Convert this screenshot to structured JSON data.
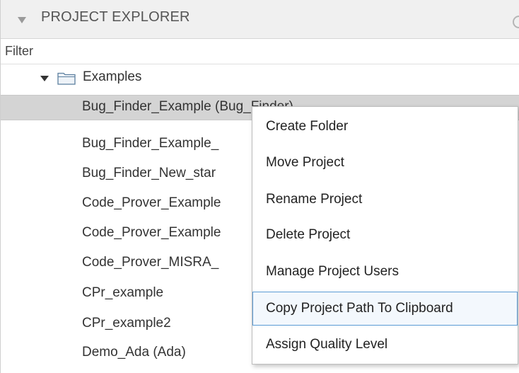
{
  "header": {
    "title": "PROJECT EXPLORER"
  },
  "filter": {
    "placeholder": "Filter",
    "value": ""
  },
  "tree": {
    "folder": {
      "label": "Examples",
      "expanded": true,
      "icon": "folder-icon"
    },
    "projects": [
      {
        "label": "Bug_Finder_Example (Bug_Finder)",
        "selected": true
      },
      {
        "label": "Bug_Finder_Example_"
      },
      {
        "label": "Bug_Finder_New_star"
      },
      {
        "label": "Code_Prover_Example"
      },
      {
        "label": "Code_Prover_Example"
      },
      {
        "label": "Code_Prover_MISRA_"
      },
      {
        "label": "CPr_example"
      },
      {
        "label": "CPr_example2"
      },
      {
        "label": "Demo_Ada (Ada)"
      }
    ]
  },
  "context_menu": {
    "items": [
      {
        "label": "Create Folder"
      },
      {
        "label": "Move Project"
      },
      {
        "label": "Rename Project"
      },
      {
        "label": "Delete Project"
      },
      {
        "label": "Manage Project Users"
      },
      {
        "label": "Copy Project Path To Clipboard",
        "highlighted": true
      },
      {
        "label": "Assign Quality Level"
      }
    ]
  },
  "colors": {
    "header_bg": "#f0f0f0",
    "selection_bg": "#d4d4d4",
    "menu_highlight_border": "#5b9bd5",
    "menu_highlight_bg": "#f3f8fd"
  }
}
